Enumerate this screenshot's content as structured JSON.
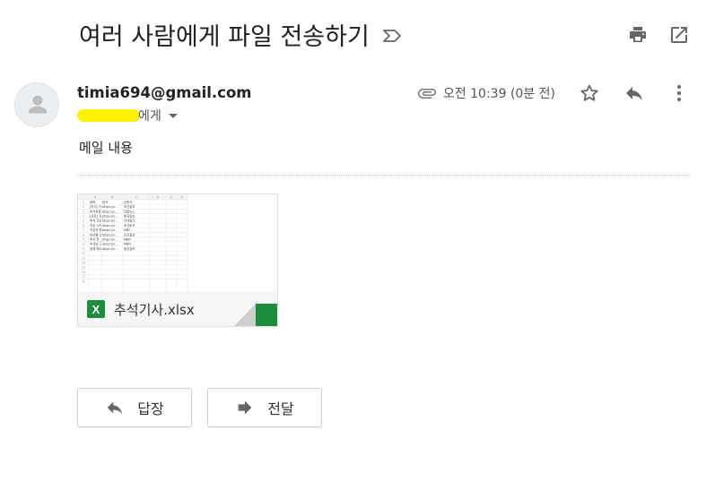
{
  "email": {
    "subject": "여러 사람에게 파일 전송하기",
    "sender": "timia694@gmail.com",
    "recipient_suffix": "에게",
    "time": "오전 10:39 (0분 전)",
    "body": "메일 내용"
  },
  "attachment": {
    "filename": "추석기사.xlsx",
    "type_letter": "X",
    "preview": {
      "columns": [
        "A",
        "B",
        "C",
        "D",
        "E",
        "F"
      ],
      "rows": [
        [
          "1",
          "제목",
          "링크",
          "신문사"
        ],
        [
          "2",
          "[추석] 귀…",
          "https://n…",
          "조선일보"
        ],
        [
          "3",
          "추석연휴…",
          "https://n…",
          "연합뉴스"
        ],
        [
          "4",
          "[포토] 귀…",
          "https://n…",
          "한국일보"
        ],
        [
          "5",
          "추석 귀성…",
          "https://n…",
          "이데일리"
        ],
        [
          "6",
          "귀성 시작…",
          "https://n…",
          "조선비즈"
        ],
        [
          "7",
          "귀성객 행…",
          "https://n…",
          "MBC"
        ],
        [
          "8",
          "부산행 귀…",
          "https://n…",
          "조선일보"
        ],
        [
          "9",
          "추석 특…",
          "https://n…",
          "MBN"
        ],
        [
          "10",
          "추석날 고…",
          "https://n…",
          "MBN"
        ],
        [
          "11",
          "정체 해소…",
          "https://n…",
          "중앙일보"
        ],
        [
          "12",
          "",
          "",
          ""
        ],
        [
          "13",
          "",
          "",
          ""
        ],
        [
          "14",
          "",
          "",
          ""
        ],
        [
          "15",
          "",
          "",
          ""
        ],
        [
          "16",
          "",
          "",
          ""
        ],
        [
          "17",
          "",
          "",
          ""
        ],
        [
          "18",
          "",
          "",
          ""
        ]
      ]
    }
  },
  "buttons": {
    "reply": "답장",
    "forward": "전달"
  },
  "colors": {
    "excel_green": "#1e8e3e",
    "redaction_yellow": "#fff200",
    "icon_gray": "#666666"
  },
  "icons": {
    "label": "label-icon",
    "print": "print-icon",
    "open_in_new": "open-in-new-icon",
    "attachment": "paperclip-icon",
    "star": "star-icon",
    "reply": "reply-icon",
    "more": "more-vert-icon",
    "forward": "forward-arrow-icon"
  }
}
